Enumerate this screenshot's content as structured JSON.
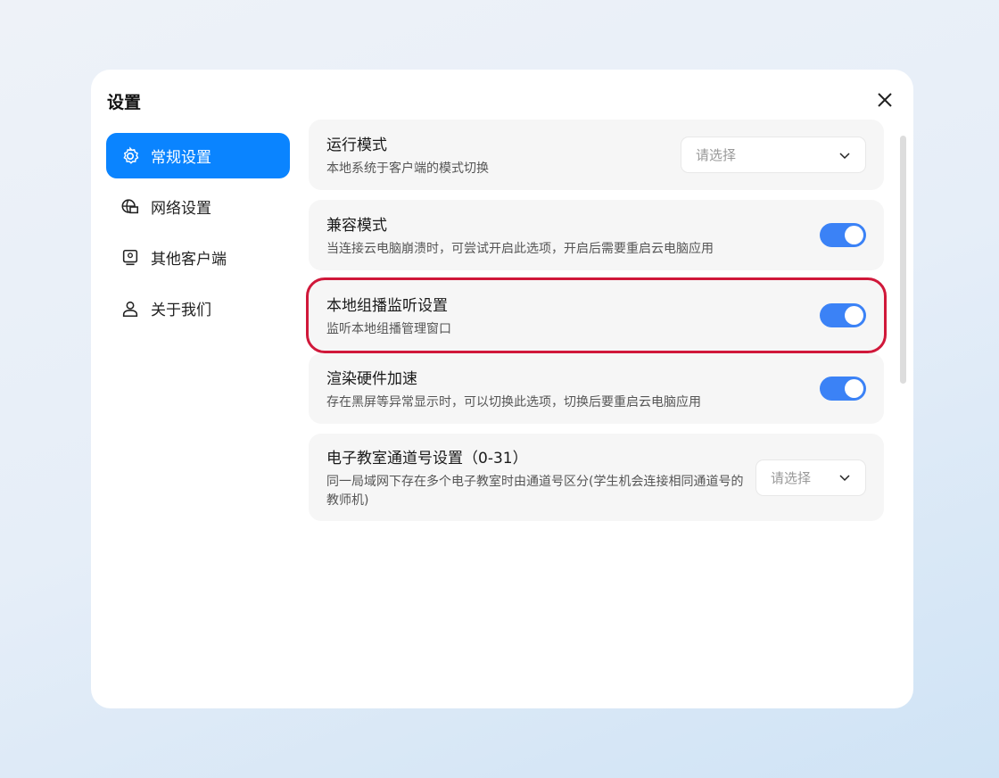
{
  "dialog": {
    "title": "设置"
  },
  "nav": [
    {
      "label": "常规设置",
      "icon": "gear-icon"
    },
    {
      "label": "网络设置",
      "icon": "network-icon"
    },
    {
      "label": "其他客户端",
      "icon": "monitor-icon"
    },
    {
      "label": "关于我们",
      "icon": "user-icon"
    }
  ],
  "settings": [
    {
      "title": "运行模式",
      "desc": "本地系统于客户端的模式切换",
      "control": "select",
      "value": "请选择"
    },
    {
      "title": "兼容模式",
      "desc": "当连接云电脑崩溃时，可尝试开启此选项，开启后需要重启云电脑应用",
      "control": "toggle",
      "on": true
    },
    {
      "title": "本地组播监听设置",
      "desc": "监听本地组播管理窗口",
      "control": "toggle",
      "on": true
    },
    {
      "title": "渲染硬件加速",
      "desc": "存在黑屏等异常显示时，可以切换此选项，切换后要重启云电脑应用",
      "control": "toggle",
      "on": true
    },
    {
      "title": "电子教室通道号设置（0-31）",
      "desc": "同一局域网下存在多个电子教室时由通道号区分(学生机会连接相同通道号的教师机)",
      "control": "select",
      "value": "请选择"
    }
  ],
  "colors": {
    "accent": "#0a84ff",
    "toggle": "#3b82f6",
    "highlight": "#d0183a"
  }
}
